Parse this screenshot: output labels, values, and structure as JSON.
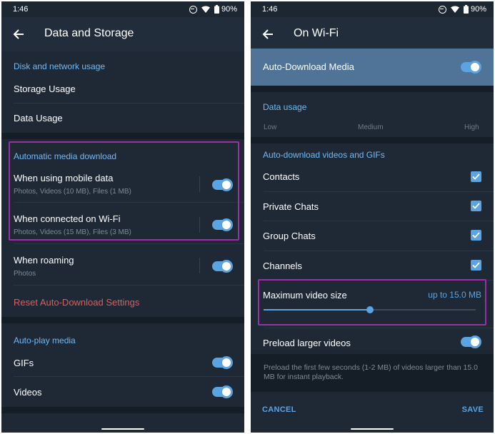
{
  "left": {
    "status": {
      "time": "1:46",
      "battery": "90%"
    },
    "title": "Data and Storage",
    "disk": {
      "header": "Disk and network usage",
      "storage_usage": "Storage Usage",
      "data_usage": "Data Usage"
    },
    "auto_download": {
      "header": "Automatic media download",
      "mobile_title": "When using mobile data",
      "mobile_sub": "Photos, Videos (10 MB), Files (1 MB)",
      "wifi_title": "When connected on Wi-Fi",
      "wifi_sub": "Photos, Videos (15 MB), Files (3 MB)",
      "roaming_title": "When roaming",
      "roaming_sub": "Photos",
      "reset": "Reset Auto-Download Settings"
    },
    "autoplay": {
      "header": "Auto-play media",
      "gifs": "GIFs",
      "videos": "Videos"
    }
  },
  "right": {
    "status": {
      "time": "1:46",
      "battery": "90%"
    },
    "title": "On Wi-Fi",
    "auto_download_media": "Auto-Download Media",
    "data_usage": {
      "header": "Data usage",
      "low": "Low",
      "medium": "Medium",
      "high": "High"
    },
    "videos_gifs": {
      "header": "Auto-download videos and GIFs",
      "contacts": "Contacts",
      "private_chats": "Private Chats",
      "group_chats": "Group Chats",
      "channels": "Channels"
    },
    "max_video": {
      "label": "Maximum video size",
      "value": "up to 15.0 MB",
      "slider_fraction": 0.5
    },
    "preload": {
      "label": "Preload larger videos",
      "note": "Preload the first few seconds (1-2 MB) of videos larger than 15.0 MB for instant playback."
    },
    "cancel": "CANCEL",
    "save": "SAVE"
  },
  "colors": {
    "accent": "#5ba3e1",
    "header_blue": "#71baf4",
    "background": "#1c2733",
    "section": "#1f2936",
    "highlight": "#9b2fa8",
    "danger": "#e05b5b"
  }
}
